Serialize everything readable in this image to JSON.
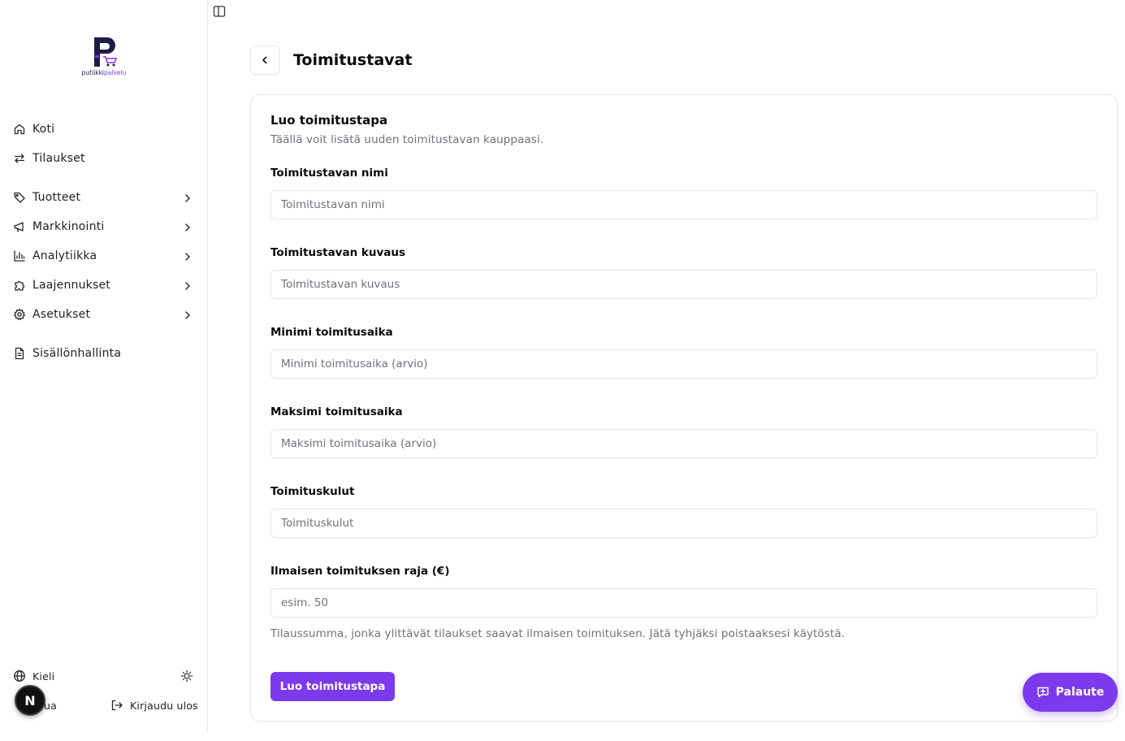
{
  "brand": {
    "logo_text_main": "putiikki",
    "logo_text_accent": "palvelu"
  },
  "sidebar": {
    "items": [
      {
        "label": "Koti",
        "icon": "home-icon"
      },
      {
        "label": "Tilaukset",
        "icon": "arrows-swap-icon"
      },
      {
        "label": "Tuotteet",
        "icon": "tag-icon"
      },
      {
        "label": "Markkinointi",
        "icon": "megaphone-icon"
      },
      {
        "label": "Analytiikka",
        "icon": "bar-chart-icon"
      },
      {
        "label": "Laajennukset",
        "icon": "puzzle-icon"
      },
      {
        "label": "Asetukset",
        "icon": "gear-icon"
      },
      {
        "label": "Sisällönhallinta",
        "icon": "document-icon"
      }
    ],
    "language_label": "Kieli",
    "user_label": "ua",
    "logout_label": "Kirjaudu ulos",
    "avatar_letter": "N"
  },
  "header": {
    "title": "Toimitustavat"
  },
  "form": {
    "title": "Luo toimitustapa",
    "description": "Täällä voit lisätä uuden toimitustavan kauppaasi.",
    "fields": [
      {
        "label": "Toimitustavan nimi",
        "placeholder": "Toimitustavan nimi",
        "value": ""
      },
      {
        "label": "Toimitustavan kuvaus",
        "placeholder": "Toimitustavan kuvaus",
        "value": ""
      },
      {
        "label": "Minimi toimitusaika",
        "placeholder": "Minimi toimitusaika (arvio)",
        "value": ""
      },
      {
        "label": "Maksimi toimitusaika",
        "placeholder": "Maksimi toimitusaika (arvio)",
        "value": ""
      },
      {
        "label": "Toimituskulut",
        "placeholder": "Toimituskulut",
        "value": ""
      },
      {
        "label": "Ilmaisen toimituksen raja (€)",
        "placeholder": "esim. 50",
        "value": ""
      }
    ],
    "help_text": "Tilaussumma, jonka ylittävät tilaukset saavat ilmaisen toimituksen. Jätä tyhjäksi poistaaksesi käytöstä.",
    "submit_label": "Luo toimitustapa"
  },
  "feedback": {
    "label": "Palaute"
  },
  "colors": {
    "accent": "#7c3aed",
    "muted_text": "#71717a",
    "border": "#e5e7eb"
  }
}
